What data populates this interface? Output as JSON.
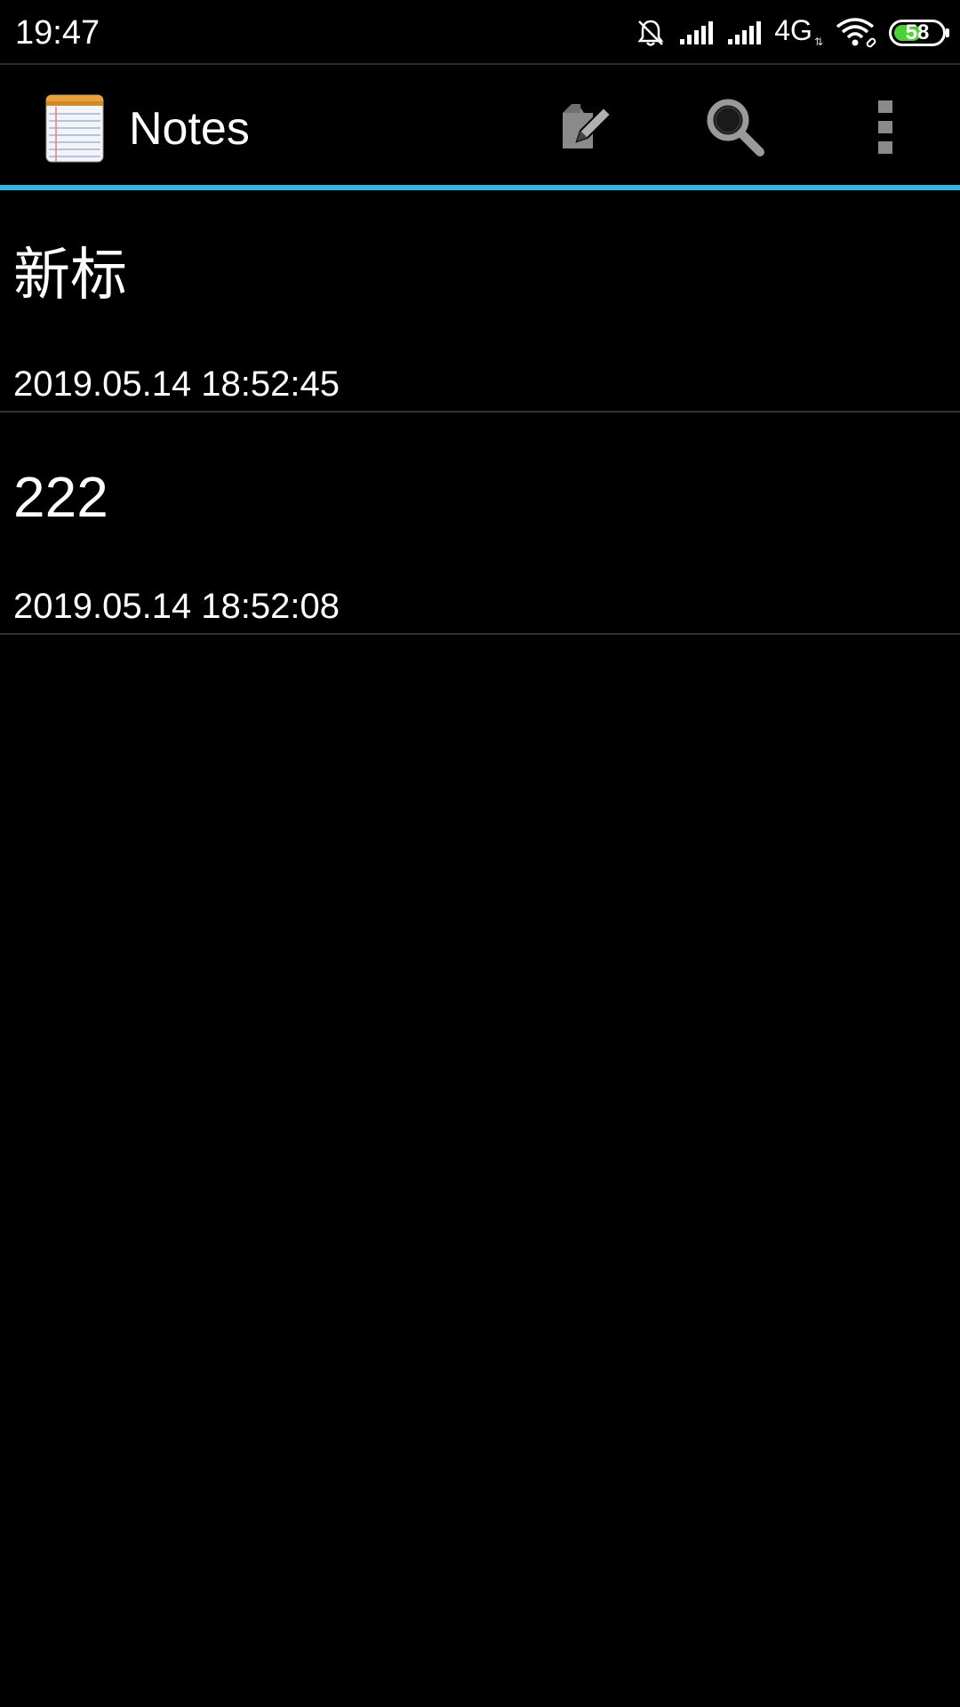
{
  "status_bar": {
    "time": "19:47",
    "network": "4G",
    "battery_level": "58",
    "battery_fraction": 0.58,
    "icons": [
      "bell-muted-icon",
      "signal-1-icon",
      "signal-2-icon",
      "data-arrows-icon",
      "wifi-icon",
      "battery-icon"
    ]
  },
  "action_bar": {
    "title": "Notes",
    "app_icon": "notepad-icon",
    "accent_color": "#33b5e5",
    "actions": [
      {
        "icon": "new-note-icon"
      },
      {
        "icon": "search-icon"
      },
      {
        "icon": "overflow-menu-icon"
      }
    ]
  },
  "notes": [
    {
      "title": "新标",
      "date": "2019.05.14 18:52:45"
    },
    {
      "title": "222",
      "date": "2019.05.14 18:52:08"
    }
  ]
}
